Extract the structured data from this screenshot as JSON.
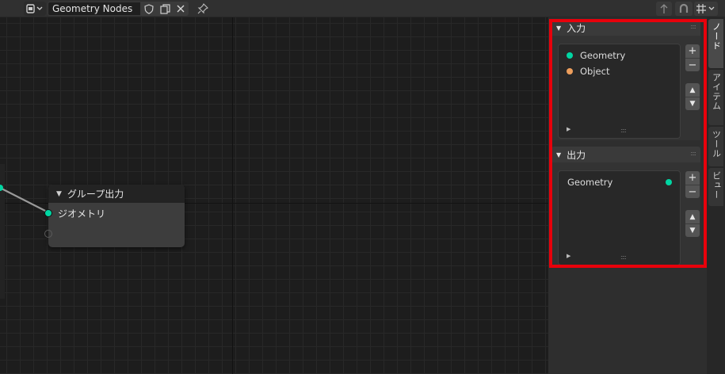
{
  "header": {
    "node_tree_name": "Geometry Nodes",
    "editor_type_icon": "node-editor-icon",
    "fake_user_icon": "shield-icon",
    "duplicate_icon": "duplicate-icon",
    "unlink_icon": "x-icon",
    "pin_icon": "pin-icon",
    "parent_icon": "arrow-up-icon",
    "snap_icon": "magnet-icon",
    "snap_type_icon": "grid-snap-icon"
  },
  "node": {
    "title": "グループ出力",
    "socket_label": "ジオメトリ",
    "socket_color": "#00d6a3"
  },
  "sidebar": {
    "inputs_panel": {
      "title": "入力",
      "items": [
        {
          "label": "Geometry",
          "color": "#00d6a3"
        },
        {
          "label": "Object",
          "color": "#ed9e5c"
        }
      ]
    },
    "outputs_panel": {
      "title": "出力",
      "items": [
        {
          "label": "Geometry",
          "color": "#00d6a3"
        }
      ]
    },
    "buttons": {
      "add": "+",
      "remove": "−",
      "move_up": "▲",
      "move_down": "▼"
    }
  },
  "tabs": [
    {
      "label": "ノード",
      "active": true
    },
    {
      "label": "アイテム",
      "active": false
    },
    {
      "label": "ツール",
      "active": false
    },
    {
      "label": "ビュー",
      "active": false
    }
  ],
  "accent_colors": {
    "highlight_border": "#e8000b"
  }
}
